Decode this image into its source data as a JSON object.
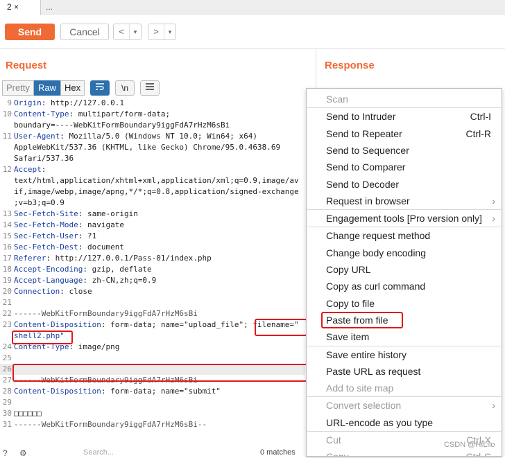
{
  "tabs": [
    {
      "label": "2 ×"
    },
    {
      "label": "..."
    }
  ],
  "toolbar": {
    "send": "Send",
    "cancel": "Cancel",
    "back": "<",
    "back_menu": "▾",
    "forward": ">",
    "forward_menu": "▾"
  },
  "request": {
    "title": "Request",
    "view_modes": [
      "Pretty",
      "Raw",
      "Hex"
    ],
    "selected_mode": "Raw",
    "icons": [
      "wrap-icon",
      "newline-icon",
      "menu-icon"
    ],
    "newline_label": "\\n",
    "lines": [
      {
        "n": "9",
        "k": "Origin",
        "v": ": http://127.0.0.1"
      },
      {
        "n": "10",
        "k": "Content-Type",
        "v": ": multipart/form-data;"
      },
      {
        "n": "",
        "k": "",
        "v": "boundary=----WebKitFormBoundary9iggFdA7rHzM6sBi"
      },
      {
        "n": "11",
        "k": "User-Agent",
        "v": ": Mozilla/5.0 (Windows NT 10.0; Win64; x64)"
      },
      {
        "n": "",
        "k": "",
        "v": "AppleWebKit/537.36 (KHTML, like Gecko) Chrome/95.0.4638.69"
      },
      {
        "n": "",
        "k": "",
        "v": "Safari/537.36"
      },
      {
        "n": "12",
        "k": "Accept",
        "v": ":"
      },
      {
        "n": "",
        "k": "",
        "v": "text/html,application/xhtml+xml,application/xml;q=0.9,image/av"
      },
      {
        "n": "",
        "k": "",
        "v": "if,image/webp,image/apng,*/*;q=0.8,application/signed-exchange"
      },
      {
        "n": "",
        "k": "",
        "v": ";v=b3;q=0.9"
      },
      {
        "n": "13",
        "k": "Sec-Fetch-Site",
        "v": ": same-origin"
      },
      {
        "n": "14",
        "k": "Sec-Fetch-Mode",
        "v": ": navigate"
      },
      {
        "n": "15",
        "k": "Sec-Fetch-User",
        "v": ": ?1"
      },
      {
        "n": "16",
        "k": "Sec-Fetch-Dest",
        "v": ": document"
      },
      {
        "n": "17",
        "k": "Referer",
        "v": ": http://127.0.0.1/Pass-01/index.php"
      },
      {
        "n": "18",
        "k": "Accept-Encoding",
        "v": ": gzip, deflate"
      },
      {
        "n": "19",
        "k": "Accept-Language",
        "v": ": zh-CN,zh;q=0.9"
      },
      {
        "n": "20",
        "k": "Connection",
        "v": ": close"
      },
      {
        "n": "21",
        "k": "",
        "v": ""
      },
      {
        "n": "22",
        "k": "",
        "v": "------WebKitFormBoundary9iggFdA7rHzM6sBi"
      },
      {
        "n": "23",
        "k": "Content-Disposition",
        "v": ": form-data; name=\"upload_file\"; filename=\""
      },
      {
        "n": "",
        "k": "",
        "v": "shell2.php\""
      },
      {
        "n": "24",
        "k": "Content-Type",
        "v": ": image/png"
      },
      {
        "n": "25",
        "k": "",
        "v": ""
      },
      {
        "n": "26",
        "k": "",
        "v": ""
      },
      {
        "n": "27",
        "k": "",
        "v": "------WebKitFormBoundary9iggFdA7rHzM6sBi"
      },
      {
        "n": "28",
        "k": "Content-Disposition",
        "v": ": form-data; name=\"submit\""
      },
      {
        "n": "29",
        "k": "",
        "v": ""
      },
      {
        "n": "30",
        "k": "",
        "v": "□□□□□□"
      },
      {
        "n": "31",
        "k": "",
        "v": "------WebKitFormBoundary9iggFdA7rHzM6sBi--"
      }
    ],
    "bottom": {
      "search_placeholder": "Search...",
      "matches": "0 matches"
    }
  },
  "response": {
    "title": "Response"
  },
  "context_menu": {
    "items": [
      {
        "label": "Scan",
        "shortcut": "",
        "disabled": true,
        "sub": false
      },
      {
        "label": "Send to Intruder",
        "shortcut": "Ctrl-I",
        "disabled": false,
        "sub": false
      },
      {
        "label": "Send to Repeater",
        "shortcut": "Ctrl-R",
        "disabled": false,
        "sub": false
      },
      {
        "label": "Send to Sequencer",
        "shortcut": "",
        "disabled": false,
        "sub": false
      },
      {
        "label": "Send to Comparer",
        "shortcut": "",
        "disabled": false,
        "sub": false
      },
      {
        "label": "Send to Decoder",
        "shortcut": "",
        "disabled": false,
        "sub": false
      },
      {
        "label": "Request in browser",
        "shortcut": "",
        "disabled": false,
        "sub": true
      },
      {
        "label": "Engagement tools [Pro version only]",
        "shortcut": "",
        "disabled": false,
        "sub": true
      },
      {
        "label": "Change request method",
        "shortcut": "",
        "disabled": false,
        "sub": false
      },
      {
        "label": "Change body encoding",
        "shortcut": "",
        "disabled": false,
        "sub": false
      },
      {
        "label": "Copy URL",
        "shortcut": "",
        "disabled": false,
        "sub": false
      },
      {
        "label": "Copy as curl command",
        "shortcut": "",
        "disabled": false,
        "sub": false
      },
      {
        "label": "Copy to file",
        "shortcut": "",
        "disabled": false,
        "sub": false
      },
      {
        "label": "Paste from file",
        "shortcut": "",
        "disabled": false,
        "sub": false,
        "highlight": true
      },
      {
        "label": "Save item",
        "shortcut": "",
        "disabled": false,
        "sub": false
      },
      {
        "label": "Save entire history",
        "shortcut": "",
        "disabled": false,
        "sub": false
      },
      {
        "label": "Paste URL as request",
        "shortcut": "",
        "disabled": false,
        "sub": false
      },
      {
        "label": "Add to site map",
        "shortcut": "",
        "disabled": true,
        "sub": false
      },
      {
        "label": "Convert selection",
        "shortcut": "",
        "disabled": true,
        "sub": true
      },
      {
        "label": "URL-encode as you type",
        "shortcut": "",
        "disabled": false,
        "sub": false
      },
      {
        "label": "Cut",
        "shortcut": "Ctrl-X",
        "disabled": true,
        "sub": false
      },
      {
        "label": "Copy",
        "shortcut": "Ctrl-C",
        "disabled": true,
        "sub": false
      }
    ]
  },
  "watermark": "CSDN @HfLllo",
  "colors": {
    "accent": "#f06a35",
    "selected": "#2e6fad",
    "highlight_box": "#e01818"
  }
}
